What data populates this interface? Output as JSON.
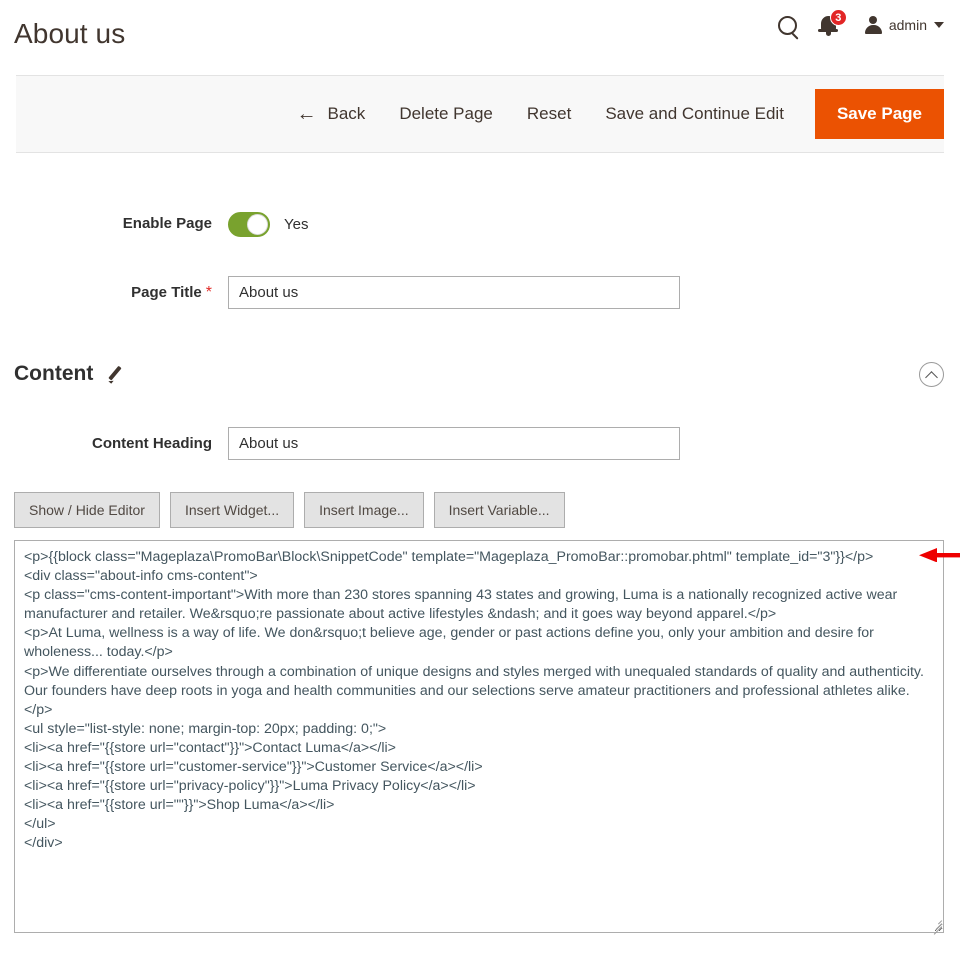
{
  "header": {
    "title": "About us",
    "search_icon": "search-icon",
    "notifications": {
      "icon": "bell-icon",
      "count": "3"
    },
    "user": {
      "icon": "user-avatar-icon",
      "name": "admin",
      "caret": "chevron-down-icon"
    }
  },
  "toolbar": {
    "back_label": "Back",
    "back_icon": "arrow-left-icon",
    "delete_label": "Delete Page",
    "reset_label": "Reset",
    "save_continue_label": "Save and Continue Edit",
    "save_label": "Save Page",
    "primary_color": "#eb5202"
  },
  "form": {
    "enable_page": {
      "label": "Enable Page",
      "value": "Yes",
      "toggle_on": true,
      "toggle_color": "#79a22e"
    },
    "page_title": {
      "label": "Page Title",
      "required_marker": "*",
      "value": "About us",
      "placeholder": ""
    }
  },
  "content_section": {
    "title": "Content",
    "edit_icon": "pencil-icon",
    "collapse_icon": "chevron-up-circle-icon",
    "content_heading": {
      "label": "Content Heading",
      "value": "About us",
      "placeholder": ""
    },
    "editor_buttons": [
      {
        "name": "show-hide-editor-button",
        "label": "Show / Hide Editor"
      },
      {
        "name": "insert-widget-button",
        "label": "Insert Widget..."
      },
      {
        "name": "insert-image-button",
        "label": "Insert Image..."
      },
      {
        "name": "insert-variable-button",
        "label": "Insert Variable..."
      }
    ],
    "code_editor": {
      "value": "<p>{{block class=\"Mageplaza\\PromoBar\\Block\\SnippetCode\" template=\"Mageplaza_PromoBar::promobar.phtml\" template_id=\"3\"}}</p>\n<div class=\"about-info cms-content\">\n<p class=\"cms-content-important\">With more than 230 stores spanning 43 states and growing, Luma is a nationally recognized active wear manufacturer and retailer. We&rsquo;re passionate about active lifestyles &ndash; and it goes way beyond apparel.</p>\n<p>At Luma, wellness is a way of life. We don&rsquo;t believe age, gender or past actions define you, only your ambition and desire for wholeness... today.</p>\n<p>We differentiate ourselves through a combination of unique designs and styles merged with unequaled standards of quality and authenticity. Our founders have deep roots in yoga and health communities and our selections serve amateur practitioners and professional athletes alike.</p>\n<ul style=\"list-style: none; margin-top: 20px; padding: 0;\">\n<li><a href=\"{{store url=\"contact\"}}\">Contact Luma</a></li>\n<li><a href=\"{{store url=\"customer-service\"}}\">Customer Service</a></li>\n<li><a href=\"{{store url=\"privacy-policy\"}}\">Luma Privacy Policy</a></li>\n<li><a href=\"{{store url=\"\"}}\">Shop Luma</a></li>\n</ul>\n</div>"
    }
  },
  "annotation": {
    "arrow_color": "#ee0000",
    "direction": "left"
  }
}
